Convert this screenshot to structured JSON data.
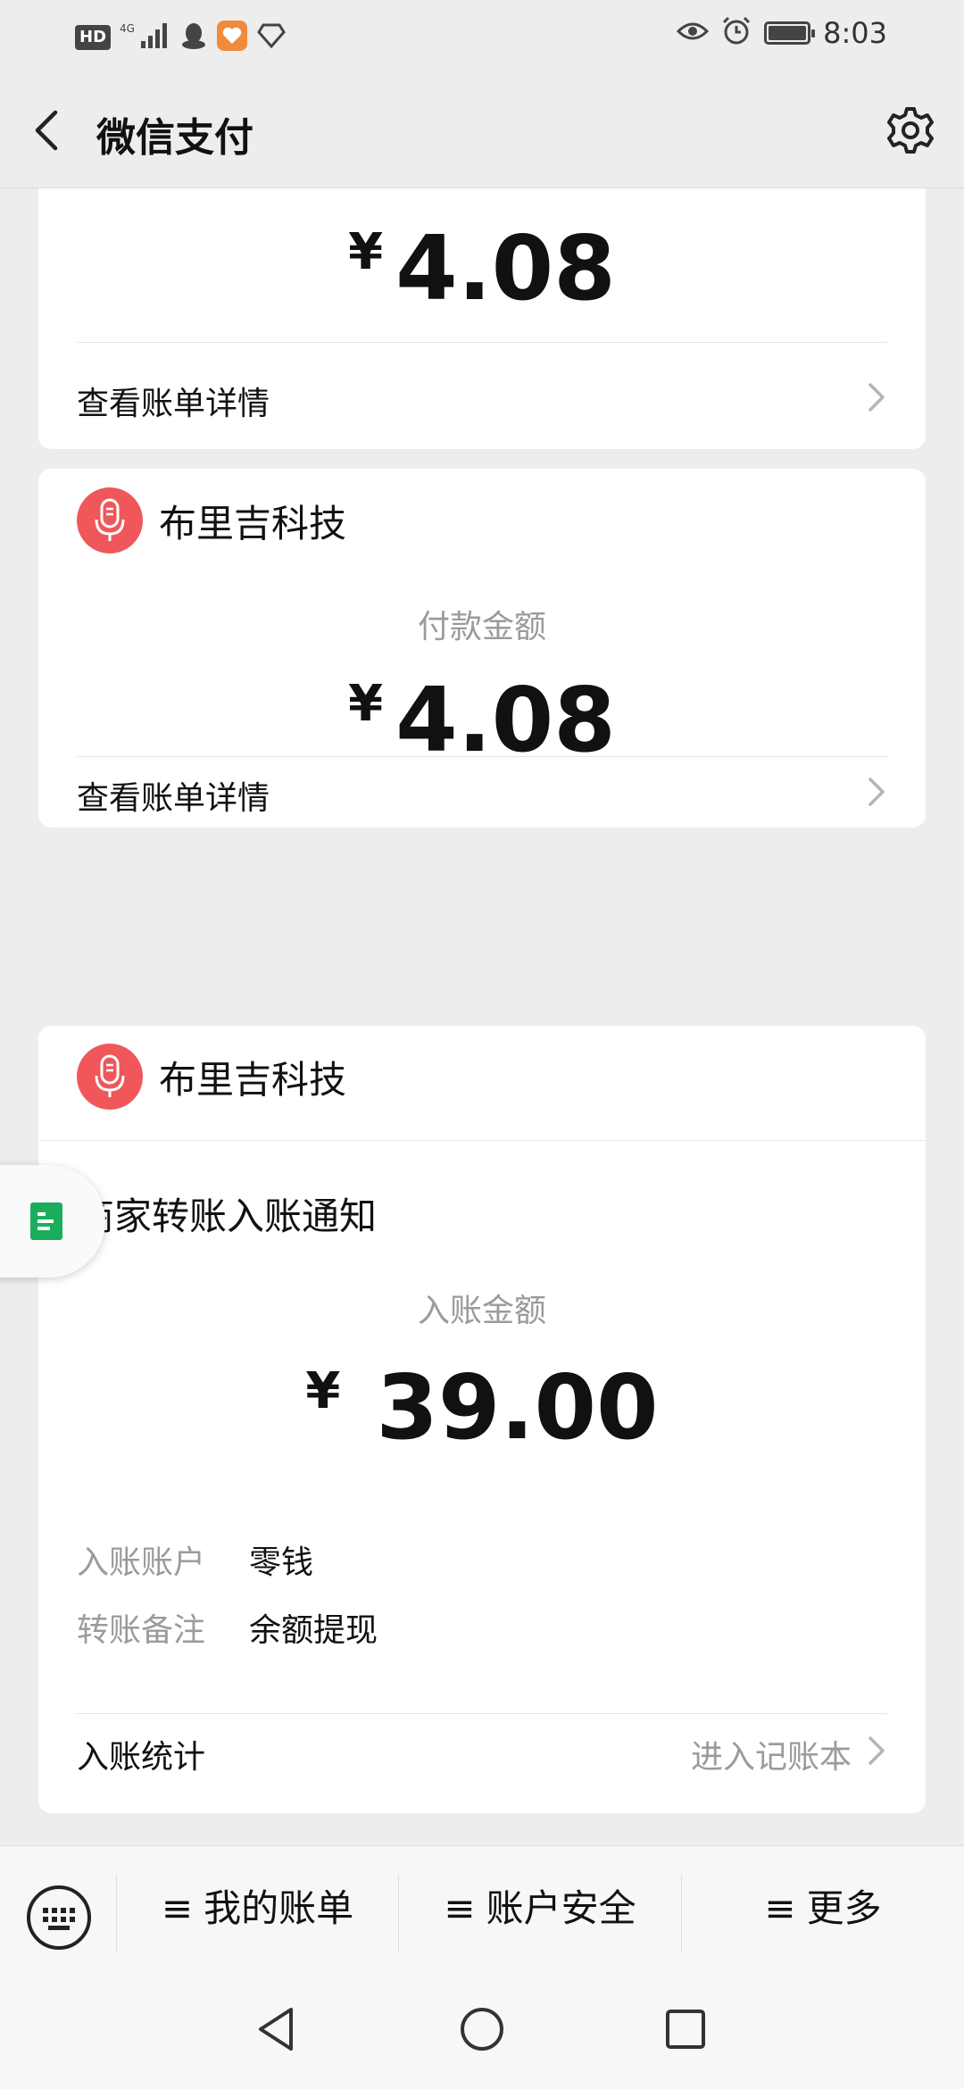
{
  "status_bar": {
    "hd_label": "HD",
    "network_label": "4G",
    "time": "8:03"
  },
  "nav": {
    "title": "微信支付"
  },
  "cards": [
    {
      "amount_currency": "¥",
      "amount": "4.08",
      "detail_link": "查看账单详情"
    },
    {
      "merchant": "布里吉科技",
      "amount_label": "付款金额",
      "amount_currency": "¥",
      "amount": "4.08",
      "detail_link": "查看账单详情"
    },
    {
      "merchant": "布里吉科技",
      "notice_title": "商家转账入账通知",
      "amount_label": "入账金额",
      "amount_currency": "¥",
      "amount": "39.00",
      "info": [
        {
          "key": "入账账户",
          "value": "零钱"
        },
        {
          "key": "转账备注",
          "value": "余额提现"
        }
      ],
      "stats_label": "入账统计",
      "stats_link": "进入记账本"
    }
  ],
  "bottom_menu": {
    "items": [
      {
        "glyph": "≡",
        "label": "我的账单"
      },
      {
        "glyph": "≡",
        "label": "账户安全"
      },
      {
        "glyph": "≡",
        "label": "更多"
      }
    ]
  },
  "colors": {
    "merchant_logo": "#f0575a",
    "float_icon": "#1aad5b",
    "background": "#ededed"
  }
}
